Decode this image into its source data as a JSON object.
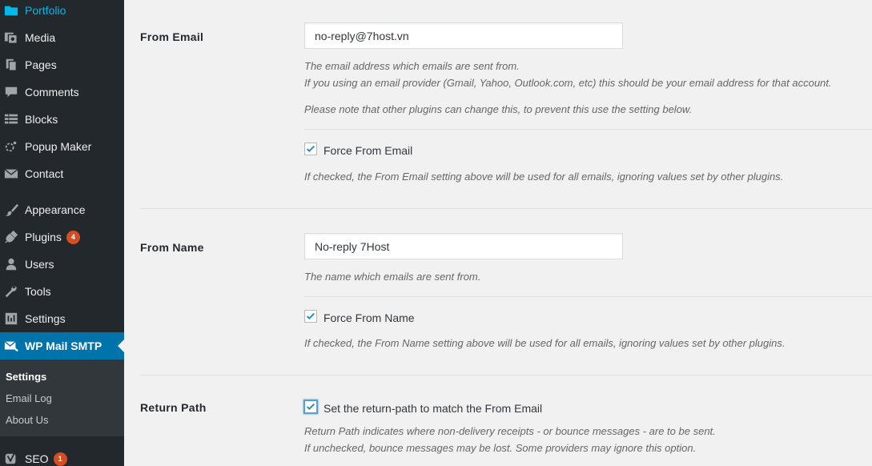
{
  "sidebar": {
    "items": [
      {
        "label": "Portfolio",
        "icon": "folder-icon"
      },
      {
        "label": "Media",
        "icon": "media-icon"
      },
      {
        "label": "Pages",
        "icon": "pages-icon"
      },
      {
        "label": "Comments",
        "icon": "comments-icon"
      },
      {
        "label": "Blocks",
        "icon": "blocks-icon"
      },
      {
        "label": "Popup Maker",
        "icon": "popup-maker-icon"
      },
      {
        "label": "Contact",
        "icon": "mail-icon"
      },
      {
        "label": "Appearance",
        "icon": "paintbrush-icon"
      },
      {
        "label": "Plugins",
        "icon": "plugins-icon",
        "badge": "4"
      },
      {
        "label": "Users",
        "icon": "users-icon"
      },
      {
        "label": "Tools",
        "icon": "wrench-icon"
      },
      {
        "label": "Settings",
        "icon": "settings-icon"
      },
      {
        "label": "WP Mail SMTP",
        "icon": "mail-smtp-icon"
      },
      {
        "label": "SEO",
        "icon": "yoast-icon",
        "badge": "1"
      }
    ],
    "submenu": [
      "Settings",
      "Email Log",
      "About Us"
    ]
  },
  "from_email": {
    "label": "From Email",
    "value": "no-reply@7host.vn",
    "desc1": "The email address which emails are sent from.",
    "desc2": "If you using an email provider (Gmail, Yahoo, Outlook.com, etc) this should be your email address for that account.",
    "note": "Please note that other plugins can change this, to prevent this use the setting below.",
    "force_label": "Force From Email",
    "force_desc": "If checked, the From Email setting above will be used for all emails, ignoring values set by other plugins.",
    "force_checked": true
  },
  "from_name": {
    "label": "From Name",
    "value": "No-reply 7Host",
    "desc": "The name which emails are sent from.",
    "force_label": "Force From Name",
    "force_desc": "If checked, the From Name setting above will be used for all emails, ignoring values set by other plugins.",
    "force_checked": true
  },
  "return_path": {
    "label": "Return Path",
    "checkbox_label": "Set the return-path to match the From Email",
    "desc1": "Return Path indicates where non-delivery receipts - or bounce messages - are to be sent.",
    "desc2": "If unchecked, bounce messages may be lost. Some providers may ignore this option.",
    "checked": true
  },
  "colors": {
    "sidebar_bg": "#23282d",
    "accent": "#0073aa",
    "portfolio": "#00b9eb",
    "badge": "#d54e21",
    "checkmark": "#1e8cbe"
  }
}
